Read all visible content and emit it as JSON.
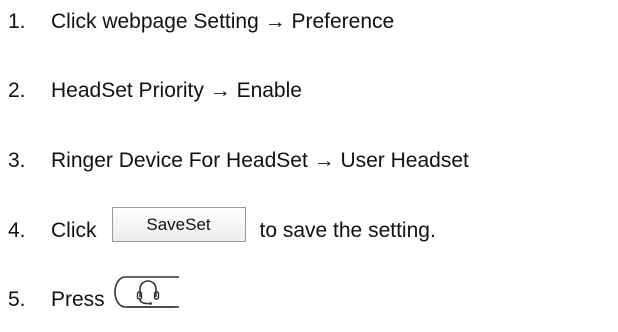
{
  "steps": [
    {
      "number": "1.",
      "text": "Click webpage Setting → Preference"
    },
    {
      "number": "2.",
      "text": "HeadSet Priority → Enable"
    },
    {
      "number": "3.",
      "text": "Ringer Device For HeadSet → User Headset"
    },
    {
      "number": "4.",
      "before": "Click",
      "button_label": "SaveSet",
      "after": "to save the setting."
    },
    {
      "number": "5.",
      "before": "Press",
      "key_icon": "headset-icon"
    }
  ]
}
